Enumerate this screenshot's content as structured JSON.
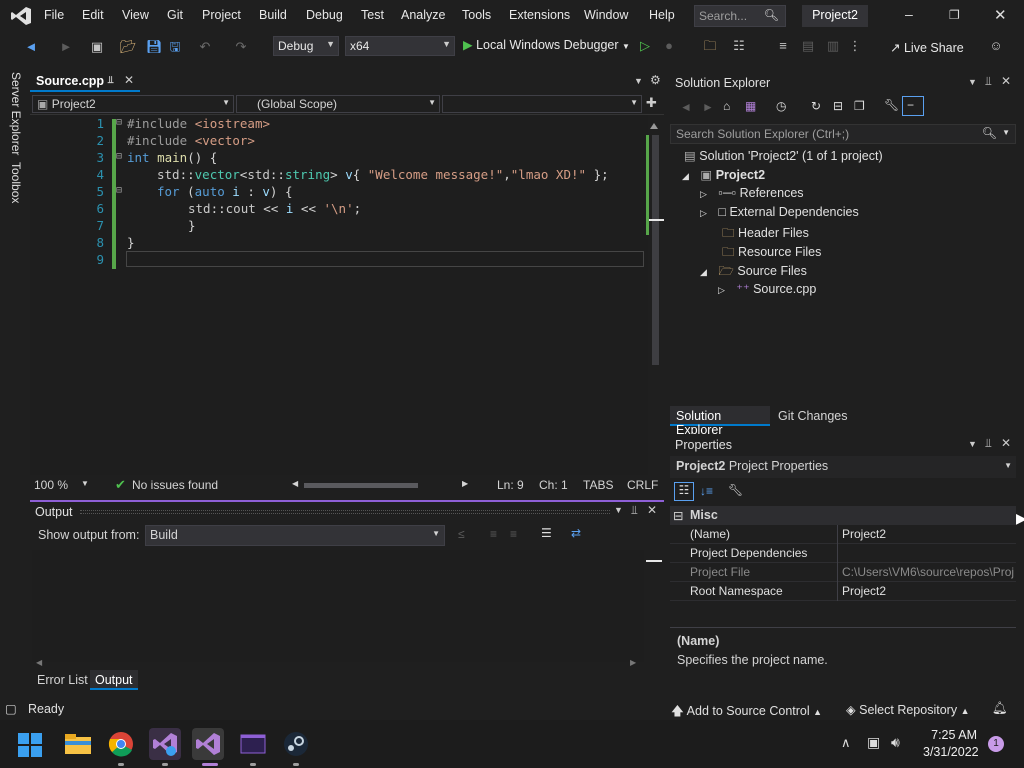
{
  "menu": {
    "items": [
      "File",
      "Edit",
      "View",
      "Git",
      "Project",
      "Build",
      "Debug",
      "Test",
      "Analyze",
      "Tools",
      "Extensions",
      "Window",
      "Help"
    ],
    "search_placeholder": "Search...",
    "project_badge": "Project2"
  },
  "toolbar": {
    "config": "Debug",
    "platform": "x64",
    "debugger_label": "Local Windows Debugger",
    "live_share": "Live Share"
  },
  "leftrail": {
    "server_explorer": "Server Explorer",
    "toolbox": "Toolbox"
  },
  "editor": {
    "tab_label": "Source.cpp",
    "nav_project": "Project2",
    "nav_scope": "(Global Scope)",
    "line_numbers": [
      "1",
      "2",
      "3",
      "4",
      "5",
      "6",
      "7",
      "8",
      "9"
    ],
    "lines": {
      "l1a": "#include ",
      "l1b": "<iostream>",
      "l2a": "#include ",
      "l2b": "<vector>",
      "l3a": "int",
      "l3b": " ",
      "l3c": "main",
      "l3d": "() {",
      "l4a": "std",
      "l4b": "::",
      "l4c": "vector",
      "l4d": "<",
      "l4e": "std",
      "l4f": "::",
      "l4g": "string",
      "l4h": "> ",
      "l4i": "v",
      "l4j": "{ ",
      "l4k": "\"Welcome message!\"",
      "l4l": ",",
      "l4m": "\"lmao XD!\"",
      "l4n": " };",
      "l5a": "for",
      "l5b": " (",
      "l5c": "auto",
      "l5d": " ",
      "l5e": "i",
      "l5f": " : ",
      "l5g": "v",
      "l5h": ") {",
      "l6a": "std",
      "l6b": "::",
      "l6c": "cout",
      "l6d": " << ",
      "l6e": "i",
      "l6f": " << ",
      "l6g": "'\\n'",
      "l6h": ";",
      "l7": "}",
      "l8": "}"
    },
    "zoom": "100 %",
    "issues": "No issues found",
    "ln": "Ln: 9",
    "ch": "Ch: 1",
    "tabs": "TABS",
    "eol": "CRLF"
  },
  "output": {
    "title": "Output",
    "show_from_label": "Show output from:",
    "source": "Build",
    "tabs": [
      "Error List",
      "Output"
    ]
  },
  "solution_explorer": {
    "title": "Solution Explorer",
    "search_placeholder": "Search Solution Explorer (Ctrl+;)",
    "solution": "Solution 'Project2' (1 of 1 project)",
    "project": "Project2",
    "nodes": [
      "References",
      "External Dependencies",
      "Header Files",
      "Resource Files",
      "Source Files"
    ],
    "source_file": "Source.cpp",
    "tabs": [
      "Solution Explorer",
      "Git Changes"
    ]
  },
  "properties": {
    "title": "Properties",
    "object_name": "Project2",
    "object_type": "Project Properties",
    "category": "Misc",
    "rows": [
      {
        "k": "(Name)",
        "v": "Project2"
      },
      {
        "k": "Project Dependencies",
        "v": ""
      },
      {
        "k": "Project File",
        "v": "C:\\Users\\VM6\\source\\repos\\Proj"
      },
      {
        "k": "Root Namespace",
        "v": "Project2"
      }
    ],
    "desc_title": "(Name)",
    "desc_text": "Specifies the project name."
  },
  "status": {
    "ready": "Ready",
    "source_control": "Add to Source Control",
    "repository": "Select Repository"
  },
  "taskbar": {
    "time": "7:25 AM",
    "date": "3/31/2022",
    "notif_count": "1"
  },
  "colors": {
    "accent": "#007acc",
    "output_border": "#8e5fd6",
    "change_bar": "#57a64a",
    "keyword": "#569cd6",
    "string": "#d69d85",
    "type": "#4ec9b0"
  }
}
